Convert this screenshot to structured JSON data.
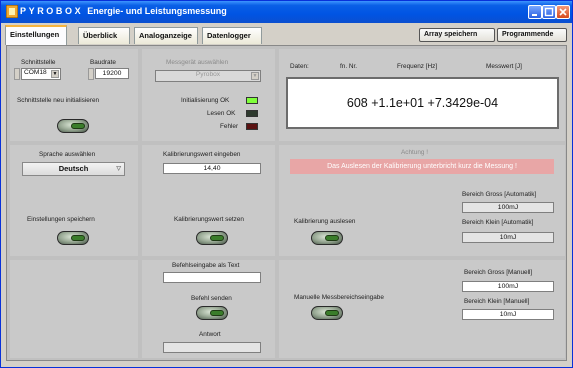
{
  "window": {
    "title_brand": "PYROBOX",
    "title_subtitle": "Energie- und Leistungsmessung"
  },
  "tabs": [
    "Einstellungen",
    "Überblick",
    "Analoganzeige",
    "Datenlogger"
  ],
  "active_tab": "Einstellungen",
  "toolbar": {
    "array_save": "Array speichern",
    "quit": "Programmende"
  },
  "interface": {
    "port_label": "Schnittstelle",
    "port_value": "COM18",
    "baud_label": "Baudrate",
    "baud_value": "19200",
    "reinit_label": "Schnittstelle neu initialisieren"
  },
  "device": {
    "select_label": "Messgerät auswählen",
    "select_value": "Pyrobox",
    "init_ok": "Initialisierung OK",
    "read_ok": "Lesen OK",
    "error": "Fehler",
    "led_colors": {
      "init": "#7fff3a",
      "read": "#2e3a2e",
      "error": "#5a1212"
    }
  },
  "data_display": {
    "col_data": "Daten:",
    "col_fn": "fn. Nr.",
    "col_freq": "Frequenz [Hz]",
    "col_value": "Messwert [J]",
    "value": "608 +1.1e+01 +7.3429e-04"
  },
  "language": {
    "label": "Sprache auswählen",
    "value": "Deutsch",
    "save_label": "Einstellungen speichern"
  },
  "calibration_value": {
    "label": "Kalibrierungswert eingeben",
    "value": "14,40",
    "set_label": "Kalibrierungswert setzen"
  },
  "calibration_read": {
    "attention": "Achtung !",
    "warning": "Das Auslesen der Kalibrierung unterbricht kurz die Messung !",
    "read_label": "Kalibrierung auslesen",
    "range_high_auto_label": "Bereich Gross [Automatik]",
    "range_high_auto_value": "100mJ",
    "range_low_auto_label": "Bereich Klein [Automatik]",
    "range_low_auto_value": "10mJ"
  },
  "command": {
    "input_label": "Befehlseingabe als Text",
    "input_value": "",
    "send_label": "Befehl senden",
    "answer_label": "Antwort",
    "answer_value": ""
  },
  "manual_range": {
    "label": "Manuelle Messbereichseingabe",
    "range_high_manual_label": "Bereich Gross [Manuell]",
    "range_high_manual_value": "100mJ",
    "range_low_manual_label": "Bereich Klein [Manuell]",
    "range_low_manual_value": "10mJ"
  }
}
